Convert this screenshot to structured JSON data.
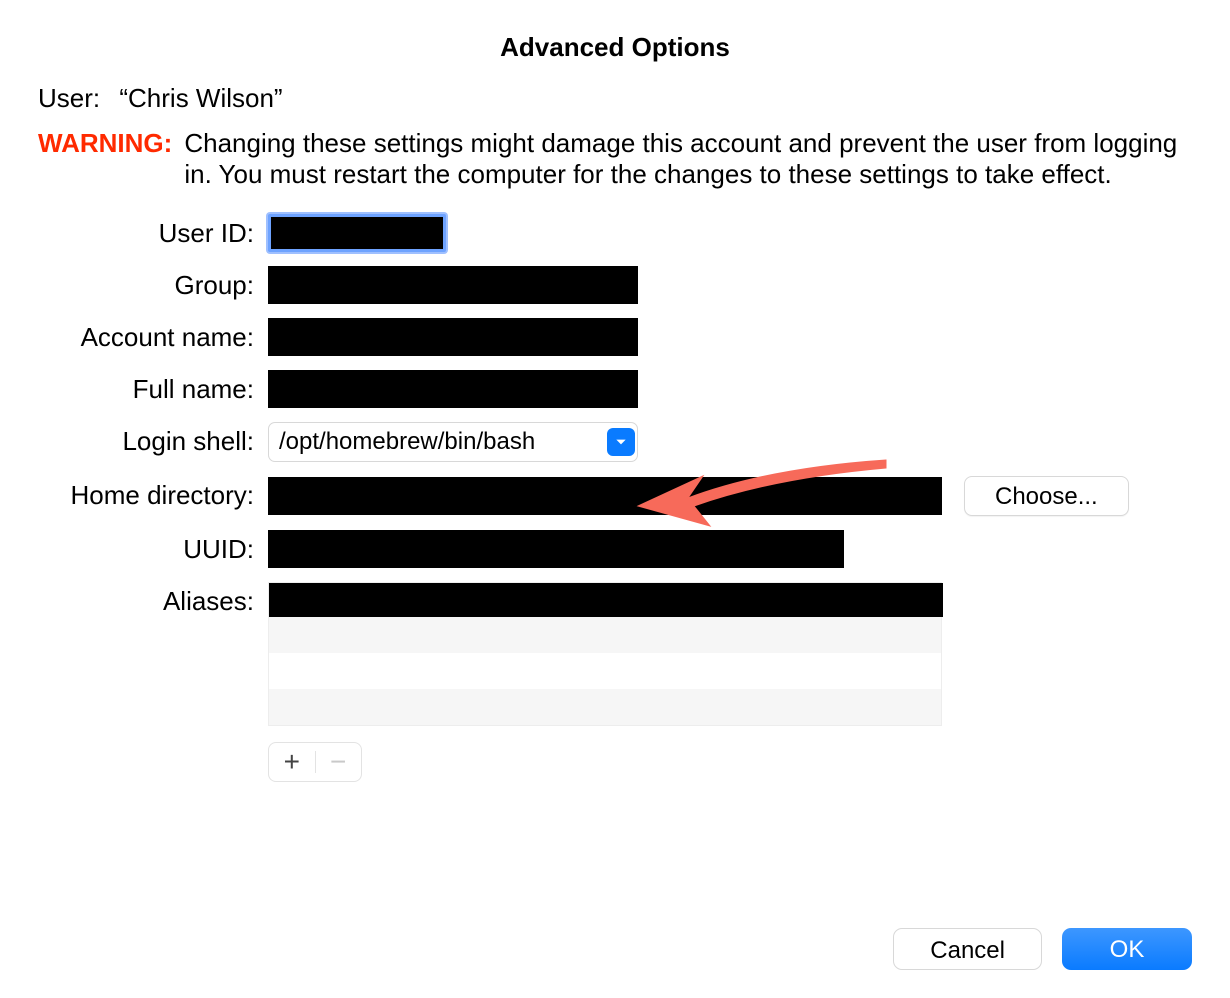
{
  "title": "Advanced Options",
  "user_label": "User:",
  "user_name": "“Chris Wilson”",
  "warning_label": "WARNING:",
  "warning_text": "Changing these settings might damage this account and prevent the user from logging in. You must restart the computer for the changes to these settings to take effect.",
  "labels": {
    "user_id": "User ID:",
    "group": "Group:",
    "account_name": "Account name:",
    "full_name": "Full name:",
    "login_shell": "Login shell:",
    "home_directory": "Home directory:",
    "uuid": "UUID:",
    "aliases": "Aliases:"
  },
  "login_shell_value": "/opt/homebrew/bin/bash",
  "choose_button": "Choose...",
  "cancel_button": "Cancel",
  "ok_button": "OK"
}
